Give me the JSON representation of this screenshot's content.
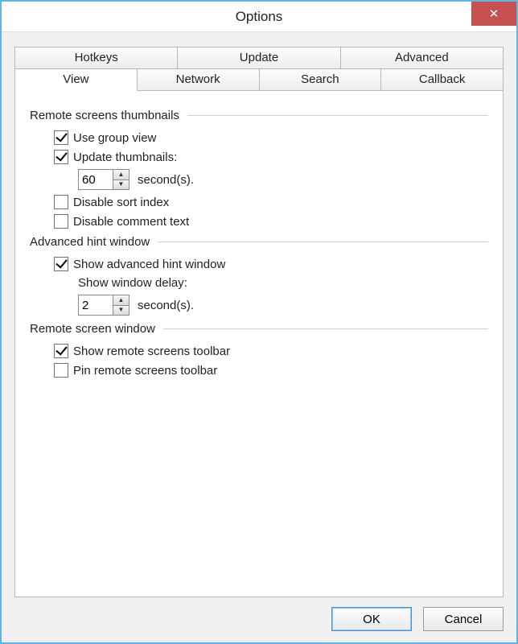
{
  "window": {
    "title": "Options"
  },
  "close_glyph": "✕",
  "tabs": {
    "row1": [
      "Hotkeys",
      "Update",
      "Advanced"
    ],
    "row2": [
      "View",
      "Network",
      "Search",
      "Callback"
    ],
    "active": "View"
  },
  "groups": {
    "remote_thumbs": {
      "title": "Remote screens thumbnails",
      "use_group_view": {
        "label": "Use group view",
        "checked": true
      },
      "update_thumbs": {
        "label": "Update thumbnails:",
        "checked": true
      },
      "interval": {
        "value": "60",
        "unit": "second(s)."
      },
      "disable_sort": {
        "label": "Disable sort index",
        "checked": false
      },
      "disable_comment": {
        "label": "Disable comment text",
        "checked": false
      }
    },
    "adv_hint": {
      "title": "Advanced hint window",
      "show_hint": {
        "label": "Show advanced hint window",
        "checked": true
      },
      "delay_label": "Show window delay:",
      "delay": {
        "value": "2",
        "unit": "second(s)."
      }
    },
    "remote_win": {
      "title": "Remote screen window",
      "show_toolbar": {
        "label": "Show remote screens toolbar",
        "checked": true
      },
      "pin_toolbar": {
        "label": "Pin remote screens toolbar",
        "checked": false
      }
    }
  },
  "buttons": {
    "ok": "OK",
    "cancel": "Cancel"
  }
}
